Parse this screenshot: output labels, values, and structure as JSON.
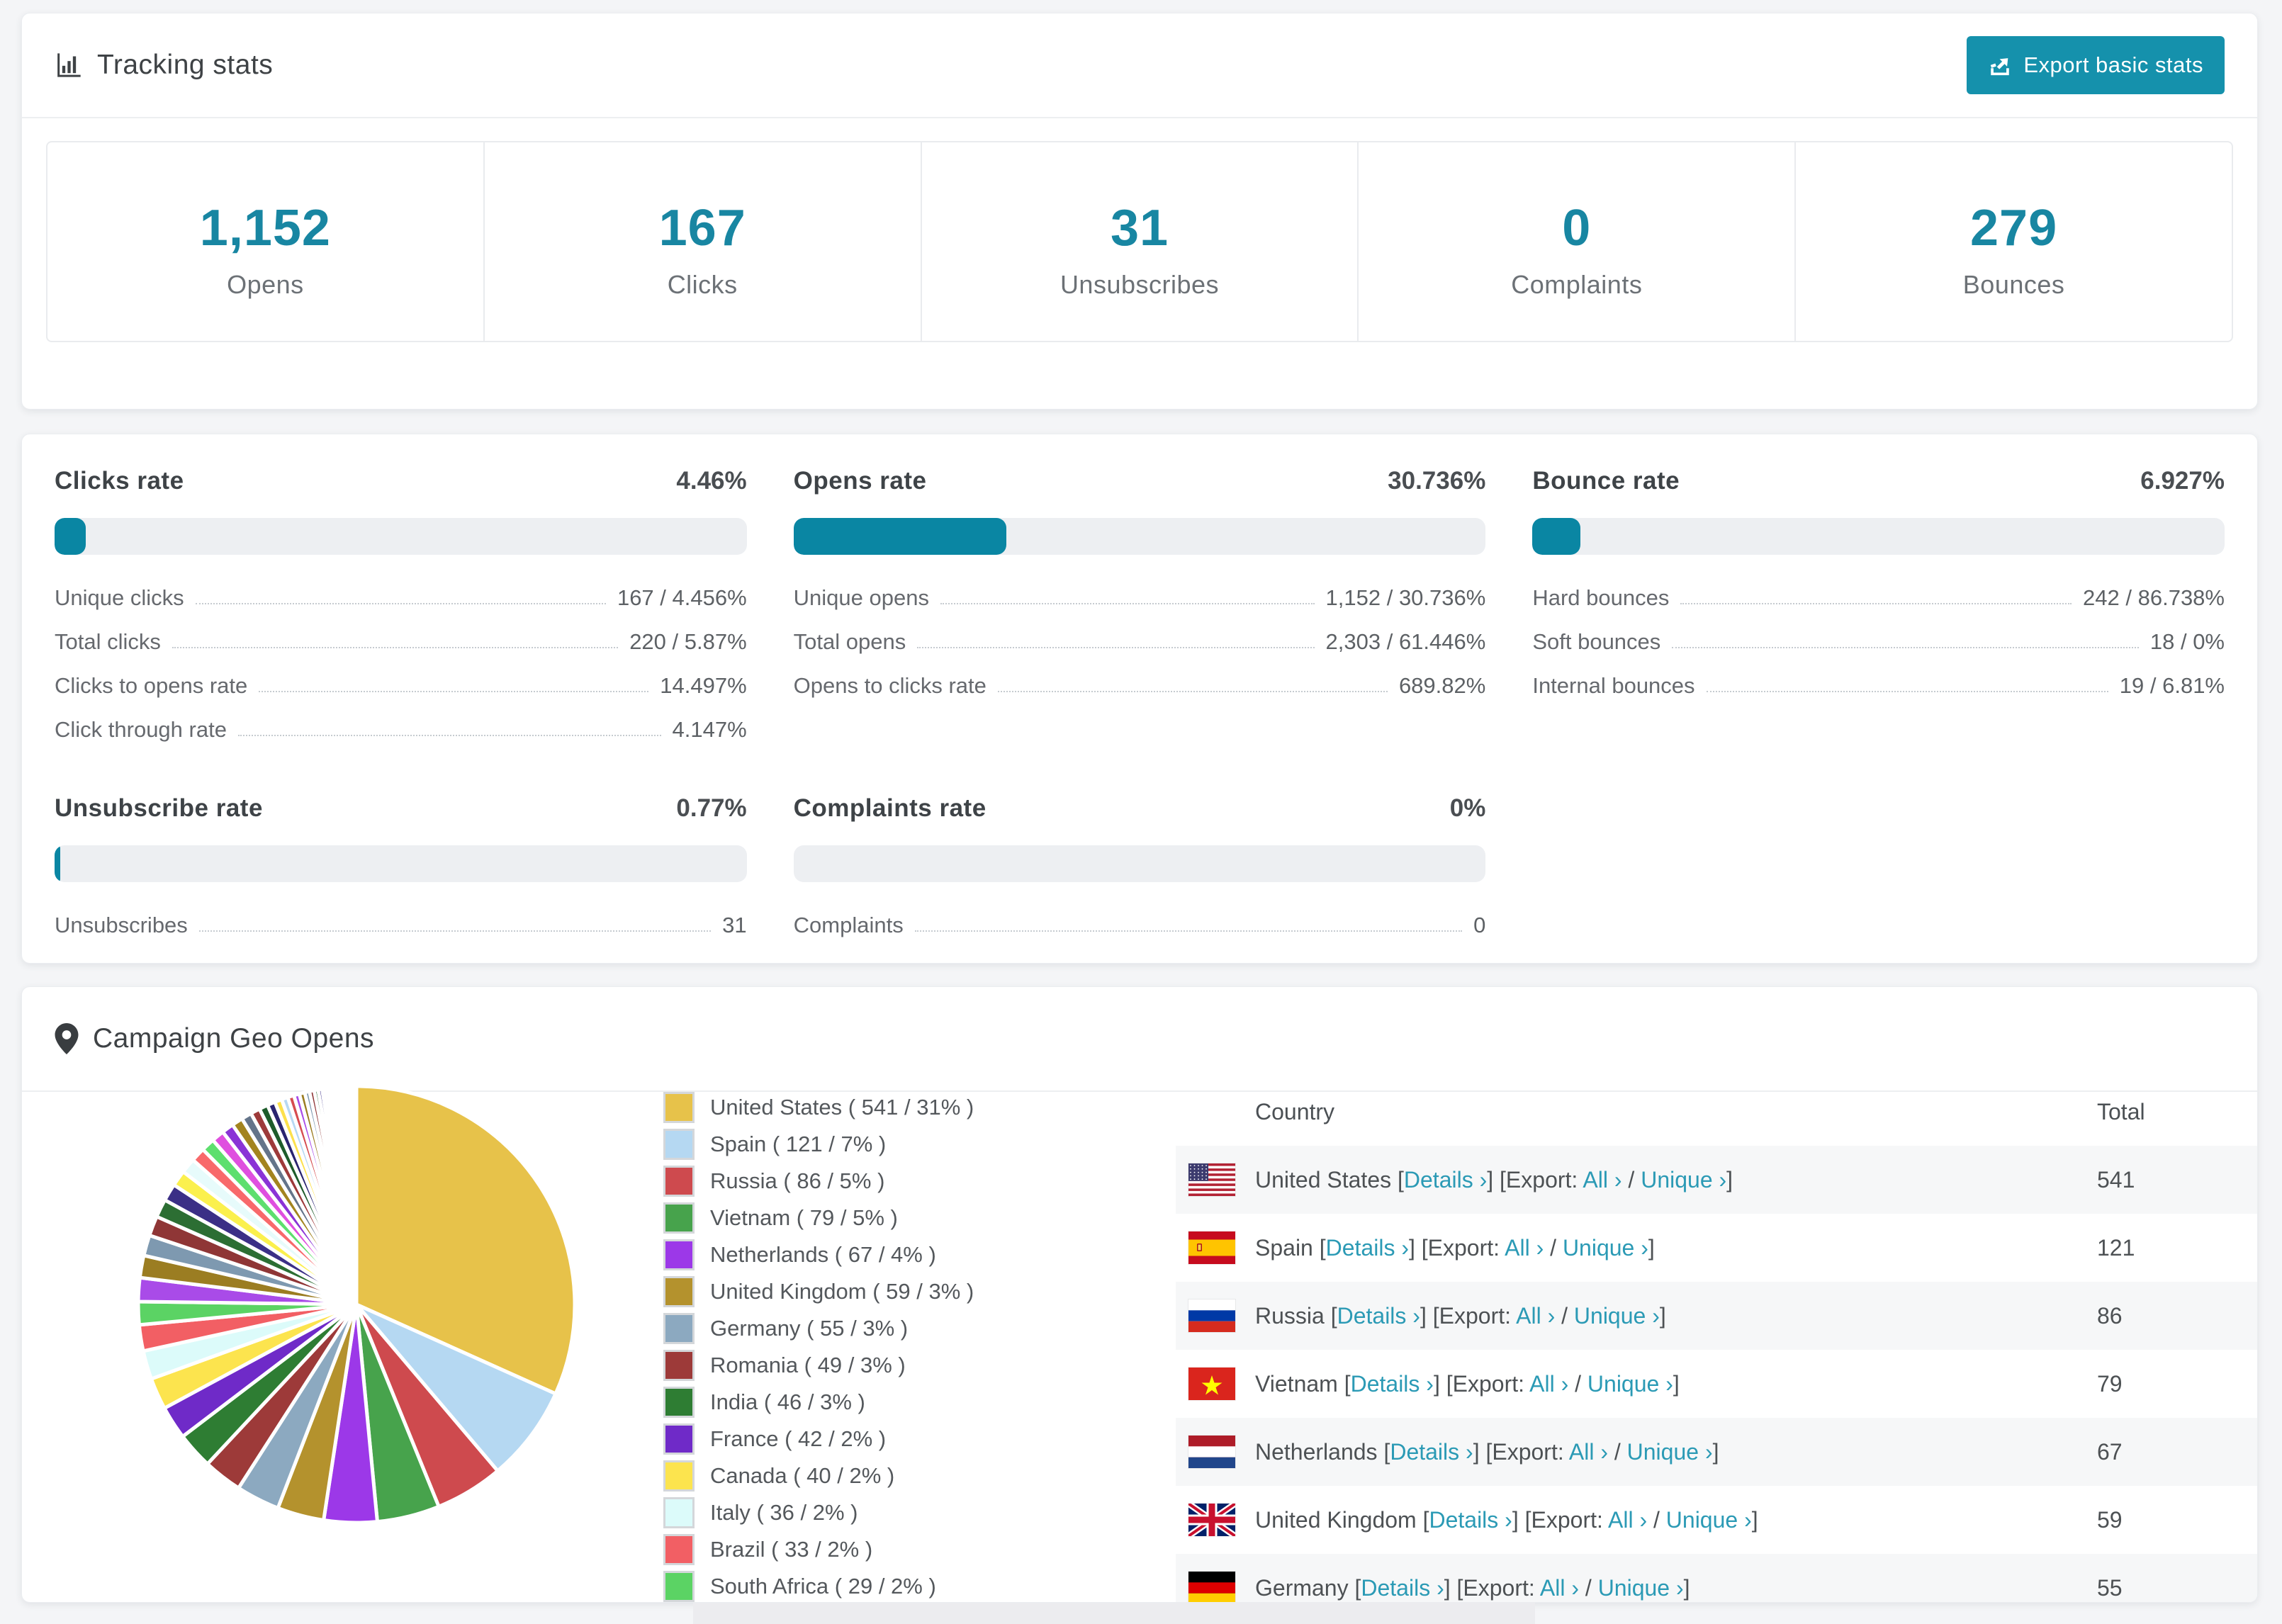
{
  "header": {
    "title": "Tracking stats",
    "export_label": "Export basic stats"
  },
  "summary": [
    {
      "value": "1,152",
      "label": "Opens"
    },
    {
      "value": "167",
      "label": "Clicks"
    },
    {
      "value": "31",
      "label": "Unsubscribes"
    },
    {
      "value": "0",
      "label": "Complaints"
    },
    {
      "value": "279",
      "label": "Bounces"
    }
  ],
  "rates": {
    "blocks": [
      {
        "key": "clicks-rate",
        "title": "Clicks rate",
        "value": "4.46%",
        "percent": 4.46,
        "rows": [
          {
            "label": "Unique clicks",
            "value": "167 / 4.456%"
          },
          {
            "label": "Total clicks",
            "value": "220 / 5.87%"
          },
          {
            "label": "Clicks to opens rate",
            "value": "14.497%"
          },
          {
            "label": "Click through rate",
            "value": "4.147%"
          }
        ]
      },
      {
        "key": "opens-rate",
        "title": "Opens rate",
        "value": "30.736%",
        "percent": 30.736,
        "rows": [
          {
            "label": "Unique opens",
            "value": "1,152 / 30.736%"
          },
          {
            "label": "Total opens",
            "value": "2,303 / 61.446%"
          },
          {
            "label": "Opens to clicks rate",
            "value": "689.82%"
          }
        ]
      },
      {
        "key": "bounce-rate",
        "title": "Bounce rate",
        "value": "6.927%",
        "percent": 6.927,
        "rows": [
          {
            "label": "Hard bounces",
            "value": "242 / 86.738%"
          },
          {
            "label": "Soft bounces",
            "value": "18 / 0%"
          },
          {
            "label": "Internal bounces",
            "value": "19 / 6.81%"
          }
        ]
      },
      {
        "key": "unsubscribe-rate",
        "title": "Unsubscribe rate",
        "value": "0.77%",
        "percent": 0.77,
        "rows": [
          {
            "label": "Unsubscribes",
            "value": "31"
          }
        ]
      },
      {
        "key": "complaints-rate",
        "title": "Complaints rate",
        "value": "0%",
        "percent": 0,
        "rows": [
          {
            "label": "Complaints",
            "value": "0"
          }
        ]
      }
    ]
  },
  "geo": {
    "title": "Campaign Geo Opens",
    "legend_fmt": {
      "open": " ( ",
      "sep": " / ",
      "close": "% )"
    },
    "fmt": {
      "l1": " [",
      "l2": "] [Export: ",
      "l3": " / ",
      "l4": "]"
    },
    "links": {
      "details": "Details ›",
      "all": "All ›",
      "unique": "Unique ›"
    },
    "table": {
      "headers": [
        "Country",
        "Total"
      ],
      "rows": [
        {
          "country": "United States",
          "total": "541",
          "flag": "us"
        },
        {
          "country": "Spain",
          "total": "121",
          "flag": "es"
        },
        {
          "country": "Russia",
          "total": "86",
          "flag": "ru"
        },
        {
          "country": "Vietnam",
          "total": "79",
          "flag": "vn"
        },
        {
          "country": "Netherlands",
          "total": "67",
          "flag": "nl"
        },
        {
          "country": "United Kingdom",
          "total": "59",
          "flag": "gb"
        },
        {
          "country": "Germany",
          "total": "55",
          "flag": "de"
        }
      ]
    }
  },
  "chart_data": {
    "type": "pie",
    "title": "Campaign Geo Opens",
    "legend_position": "right",
    "countries": [
      {
        "name": "United States",
        "value": 541,
        "pct": 31,
        "color": "#e7c24a"
      },
      {
        "name": "Spain",
        "value": 121,
        "pct": 7,
        "color": "#b5d8f2"
      },
      {
        "name": "Russia",
        "value": 86,
        "pct": 5,
        "color": "#ce4a4e"
      },
      {
        "name": "Vietnam",
        "value": 79,
        "pct": 5,
        "color": "#47a34c"
      },
      {
        "name": "Netherlands",
        "value": 67,
        "pct": 4,
        "color": "#9c38e8"
      },
      {
        "name": "United Kingdom",
        "value": 59,
        "pct": 3,
        "color": "#b4922d"
      },
      {
        "name": "Germany",
        "value": 55,
        "pct": 3,
        "color": "#8ca9c0"
      },
      {
        "name": "Romania",
        "value": 49,
        "pct": 3,
        "color": "#9d3a39"
      },
      {
        "name": "India",
        "value": 46,
        "pct": 3,
        "color": "#2e7d33"
      },
      {
        "name": "France",
        "value": 42,
        "pct": 2,
        "color": "#6f2ac8"
      },
      {
        "name": "Canada",
        "value": 40,
        "pct": 2,
        "color": "#fce44e"
      },
      {
        "name": "Italy",
        "value": 36,
        "pct": 2,
        "color": "#dcfbfa"
      },
      {
        "name": "Brazil",
        "value": 33,
        "pct": 2,
        "color": "#f25f64"
      },
      {
        "name": "South Africa",
        "value": 29,
        "pct": 2,
        "color": "#5bd364"
      }
    ],
    "others_values": [
      30,
      28,
      26,
      25,
      23,
      22,
      20,
      19,
      18,
      17,
      16,
      15,
      14,
      13,
      12,
      11,
      10,
      9,
      8,
      8,
      7,
      7,
      6,
      6,
      5,
      5,
      4,
      4,
      3,
      3,
      3,
      3,
      2,
      2,
      2,
      2,
      2,
      1,
      1,
      1,
      1,
      1,
      1,
      1,
      1,
      1,
      1,
      1,
      1,
      1
    ],
    "others_colors": [
      "#a94be8",
      "#9b7d22",
      "#7e99b0",
      "#8f3636",
      "#2c6e33",
      "#3b2f86",
      "#fbf04d",
      "#e7fbfb",
      "#f8696b",
      "#5ddf6e",
      "#df4fdf",
      "#8a33d6",
      "#a3841f",
      "#64748a",
      "#9d3a3a",
      "#1e5c2b",
      "#2a2470",
      "#fde14c",
      "#b7d9f3",
      "#d64c50"
    ]
  }
}
